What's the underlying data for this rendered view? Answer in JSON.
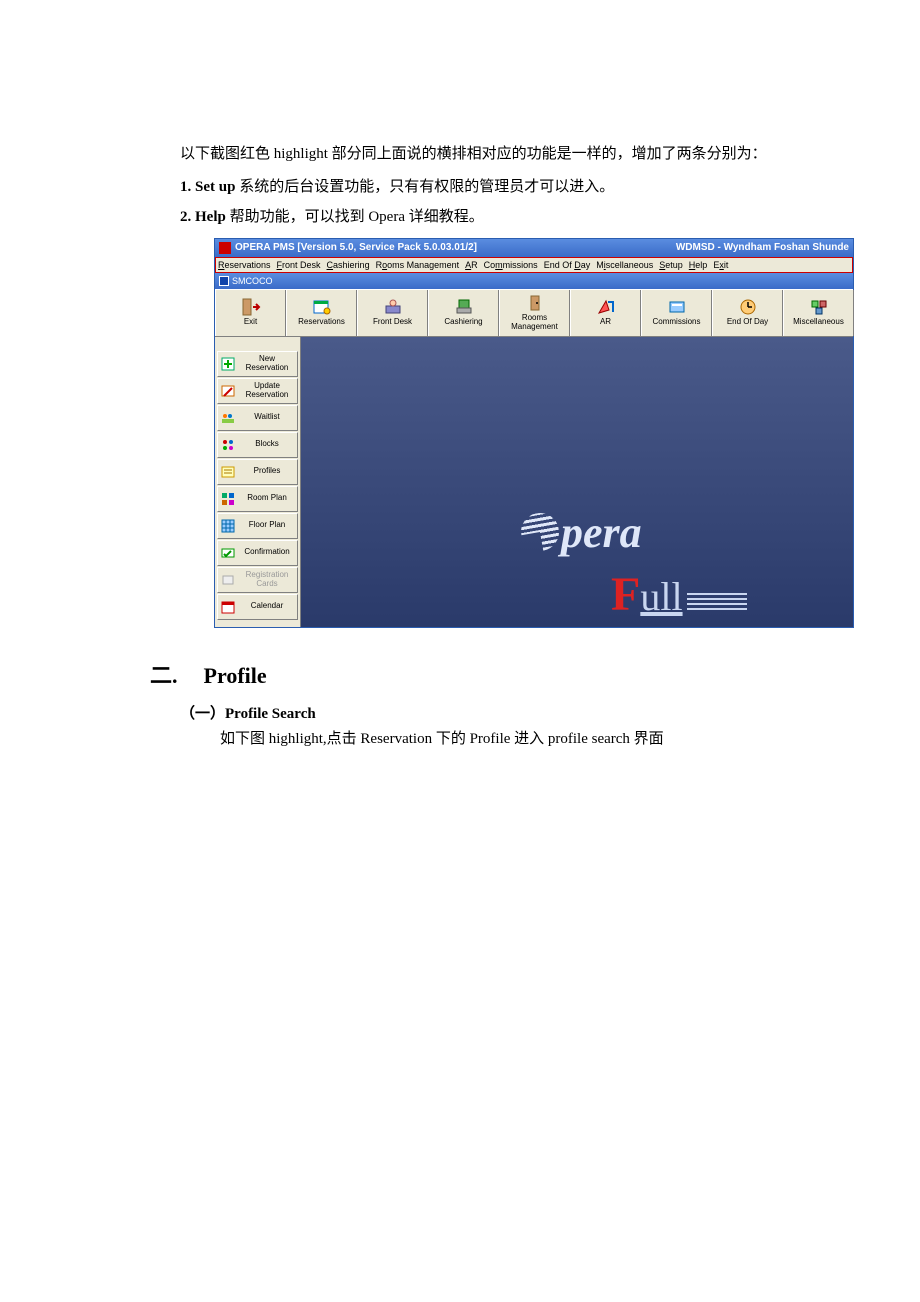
{
  "doc": {
    "intro": "以下截图红色 highlight 部分同上面说的横排相对应的功能是一样的，增加了两条分别为：",
    "item1_num": "1.",
    "item1_bold": "Set up",
    "item1_rest": "  系统的后台设置功能，只有有权限的管理员才可以进入。",
    "item2_num": "2.",
    "item2_bold": "Help",
    "item2_rest": "  帮助功能，可以找到 Opera 详细教程。",
    "sec2_num": "二.",
    "sec2_title": "Profile",
    "sec2_sub_num": "（一）",
    "sec2_sub_title": "Profile Search",
    "sec2_body": "如下图 highlight,点击 Reservation 下的 Profile  进入 profile search 界面"
  },
  "app": {
    "title_left": "OPERA PMS [Version 5.0, Service Pack 5.0.03.01/2]",
    "title_right": "WDMSD - Wyndham Foshan Shunde",
    "mdi_label": "SMCOCO",
    "menus": [
      "Reservations",
      "Front Desk",
      "Cashiering",
      "Rooms Management",
      "AR",
      "Commissions",
      "End Of Day",
      "Miscellaneous",
      "Setup",
      "Help",
      "Exit"
    ],
    "toolbar": [
      {
        "label": "Exit",
        "icon": "door-exit-icon"
      },
      {
        "label": "Reservations",
        "icon": "reservation-icon"
      },
      {
        "label": "Front Desk",
        "icon": "front-desk-icon"
      },
      {
        "label": "Cashiering",
        "icon": "cashier-icon"
      },
      {
        "label": "Rooms Management",
        "icon": "rooms-icon"
      },
      {
        "label": "AR",
        "icon": "ar-icon"
      },
      {
        "label": "Commissions",
        "icon": "commissions-icon"
      },
      {
        "label": "End Of Day",
        "icon": "eod-icon"
      },
      {
        "label": "Miscellaneous",
        "icon": "misc-icon"
      }
    ],
    "sidebar": [
      {
        "label": "New Reservation",
        "icon": "new-resv-icon",
        "disabled": false
      },
      {
        "label": "Update Reservation",
        "icon": "update-resv-icon",
        "disabled": false
      },
      {
        "label": "Waitlist",
        "icon": "waitlist-icon",
        "disabled": false
      },
      {
        "label": "Blocks",
        "icon": "blocks-icon",
        "disabled": false
      },
      {
        "label": "Profiles",
        "icon": "profiles-icon",
        "disabled": false
      },
      {
        "label": "Room Plan",
        "icon": "room-plan-icon",
        "disabled": false
      },
      {
        "label": "Floor Plan",
        "icon": "floor-plan-icon",
        "disabled": false
      },
      {
        "label": "Confirmation",
        "icon": "confirmation-icon",
        "disabled": false
      },
      {
        "label": "Registration Cards",
        "icon": "reg-cards-icon",
        "disabled": true
      },
      {
        "label": "Calendar",
        "icon": "calendar-icon",
        "disabled": false
      }
    ],
    "logo1": "pera",
    "logo2_f": "F",
    "logo2_ull": "ull"
  }
}
